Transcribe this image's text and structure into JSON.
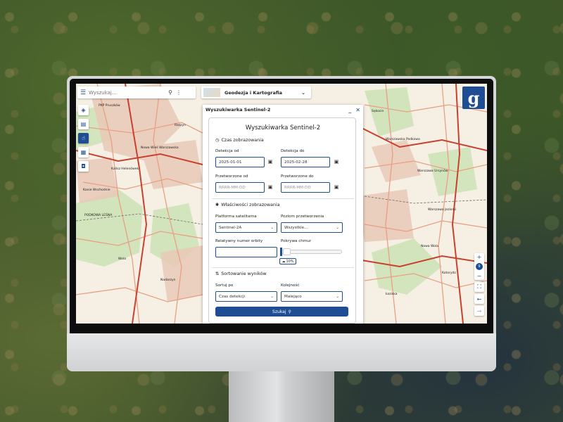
{
  "topbar": {
    "search_placeholder": "Wyszukaj...",
    "layer_name": "Geodezja i Kartografia"
  },
  "map_labels": [
    "PKP Pruszków",
    "Nowa Wieś Warszawska",
    "Raszyn",
    "Kalisz Helenówek",
    "Kanie Wschodnie",
    "PODKOWA LEŚNA",
    "Nadarzyn",
    "Wola",
    "Warszawska Podkowa",
    "Warszawa Ursynów",
    "Warszawa Jeziorki",
    "Nowa Wola",
    "Łoziska",
    "Kotorydz",
    "Sękocin"
  ],
  "panel": {
    "header_title": "Wyszukiwarka Sentinel-2",
    "minimize_label": "_",
    "close_label": "✕",
    "card_title": "Wyszukiwarka Sentinel-2",
    "time_section": {
      "icon": "clock-icon",
      "title": "Czas zobrazowania",
      "detection_from_label": "Detekcja od",
      "detection_from_value": "2025-01-01",
      "detection_to_label": "Detekcja do",
      "detection_to_value": "2025-02-28",
      "processed_from_label": "Przetworzone od",
      "processed_from_placeholder": "RRRR-MM-DD",
      "processed_to_label": "Przetworzone do",
      "processed_to_placeholder": "RRRR-MM-DD"
    },
    "props_section": {
      "icon": "gear-icon",
      "title": "Właściwości zobrazowania",
      "platform_label": "Platforma satelitarna",
      "platform_value": "Sentinel-2A",
      "level_label": "Poziom przetworzenia",
      "level_value": "Wszystkie...",
      "orbit_label": "Relatywny numer orbity",
      "orbit_value": "",
      "cloud_label": "Pokrywa chmur",
      "cloud_fraction": 0.1,
      "cloud_badge": "10%"
    },
    "sort_section": {
      "icon": "sort-icon",
      "title": "Sortowanie wyników",
      "sort_by_label": "Sortuj po",
      "sort_by_value": "Czas detekcji",
      "order_label": "Kolejność",
      "order_value": "Malejąco"
    },
    "search_button": "Szukaj"
  },
  "colors": {
    "accent": "#1e4d93",
    "road_major": "#c8412e",
    "road_minor": "#e8a084"
  }
}
